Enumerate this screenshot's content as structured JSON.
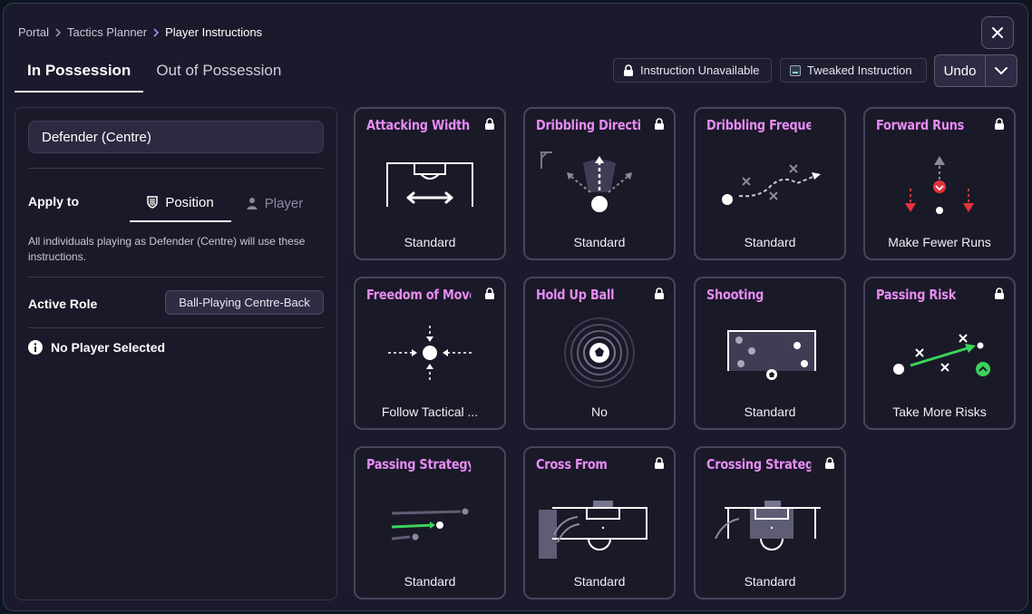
{
  "breadcrumb": [
    "Portal",
    "Tactics Planner",
    "Player Instructions"
  ],
  "tabs": [
    {
      "label": "In Possession",
      "active": true
    },
    {
      "label": "Out of Possession",
      "active": false
    }
  ],
  "legend": {
    "unavailable": "Instruction Unavailable",
    "tweaked": "Tweaked Instruction"
  },
  "undo": {
    "label": "Undo"
  },
  "sidebar": {
    "role_select": "Defender (Centre)",
    "apply_to_label": "Apply to",
    "apply_to_options": [
      {
        "label": "Position",
        "icon": "shield-icon",
        "active": true
      },
      {
        "label": "Player",
        "icon": "person-icon",
        "active": false
      }
    ],
    "description": "All individuals playing as Defender (Centre) will use these instructions.",
    "active_role_label": "Active Role",
    "active_role_value": "Ball-Playing Centre-Back",
    "no_player": "No Player Selected"
  },
  "colors": {
    "accent": "#a98bf2",
    "title_pink": "#e68cf3",
    "positive_green": "#3ad35a",
    "negative_red": "#e3333c"
  },
  "instructions": [
    {
      "title": "Attacking Width",
      "value": "Standard",
      "locked": true
    },
    {
      "title": "Dribbling Direction",
      "value": "Standard",
      "locked": true
    },
    {
      "title": "Dribbling Frequency",
      "value": "Standard",
      "locked": false
    },
    {
      "title": "Forward Runs",
      "value": "Make Fewer Runs",
      "locked": true
    },
    {
      "title": "Freedom of Movement",
      "value": "Follow Tactical ...",
      "locked": true
    },
    {
      "title": "Hold Up Ball",
      "value": "No",
      "locked": true
    },
    {
      "title": "Shooting",
      "value": "Standard",
      "locked": false
    },
    {
      "title": "Passing Risk",
      "value": "Take More Risks",
      "locked": true
    },
    {
      "title": "Passing Strategy",
      "value": "Standard",
      "locked": false
    },
    {
      "title": "Cross From",
      "value": "Standard",
      "locked": true
    },
    {
      "title": "Crossing Strategy",
      "value": "Standard",
      "locked": true
    }
  ]
}
